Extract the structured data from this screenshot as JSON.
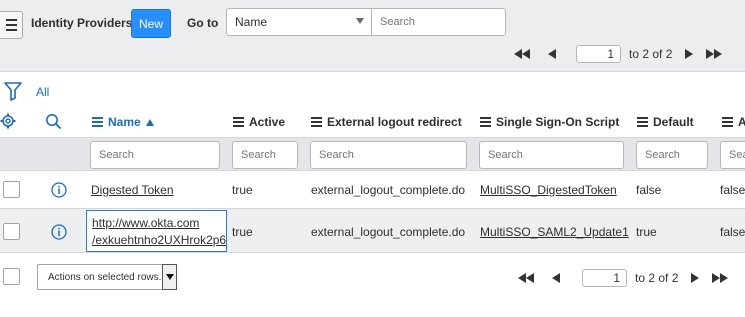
{
  "header": {
    "title": "Identity Providers",
    "new_label": "New",
    "goto_label": "Go to",
    "goto_field": "Name",
    "search_placeholder": "Search"
  },
  "pager": {
    "current_page": "1",
    "range_text": "to 2 of 2"
  },
  "breadcrumb": {
    "all_label": "All"
  },
  "columns": [
    {
      "label": "Name",
      "sorted": "ascending"
    },
    {
      "label": "Active"
    },
    {
      "label": "External logout redirect"
    },
    {
      "label": "Single Sign-On Script"
    },
    {
      "label": "Default"
    },
    {
      "label": "A"
    }
  ],
  "column_search_placeholder": "Search",
  "rows": [
    {
      "name": "Digested Token",
      "active": "true",
      "external_logout_redirect": "external_logout_complete.do",
      "sso_script": "MultiSSO_DigestedToken",
      "default": "false",
      "extra": "false"
    },
    {
      "name_line1": "http://www.okta.com",
      "name_line2": "/exkuehtnho2UXHrok2p6",
      "active": "true",
      "external_logout_redirect": "external_logout_complete.do",
      "sso_script": "MultiSSO_SAML2_Update1",
      "default": "true",
      "extra": "false"
    }
  ],
  "footer": {
    "actions_label": "Actions on selected rows...",
    "current_page": "1",
    "range_text": "to 2 of 2"
  },
  "colors": {
    "primary_button": "#278efc",
    "link": "#1f6bb8",
    "header_bg": "#ebedef"
  }
}
